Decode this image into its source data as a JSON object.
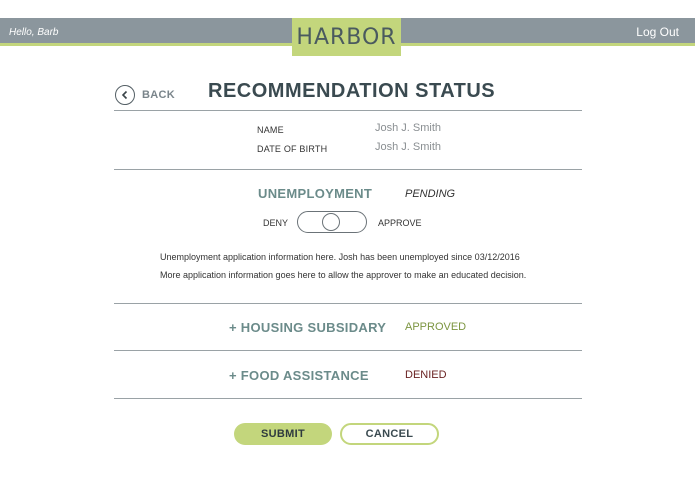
{
  "header": {
    "greeting": "Hello, Barb",
    "logo": "HARBOR",
    "logout_label": "Log Out"
  },
  "nav": {
    "back_label": "BACK"
  },
  "page": {
    "title": "RECOMMENDATION STATUS"
  },
  "person": {
    "name_label": "NAME",
    "name_value": "Josh J. Smith",
    "dob_label": "DATE OF BIRTH",
    "dob_value": "Josh J. Smith"
  },
  "unemployment": {
    "title": "UNEMPLOYMENT",
    "status": "PENDING",
    "deny_label": "DENY",
    "approve_label": "APPROVE",
    "info_line1": "Unemployment application information here. Josh has been unemployed since 03/12/2016",
    "info_line2": "More application information goes here to allow the approver to make an educated decision."
  },
  "housing": {
    "title": "+ HOUSING SUBSIDARY",
    "status": "APPROVED"
  },
  "food": {
    "title": "+ FOOD ASSISTANCE",
    "status": "DENIED"
  },
  "actions": {
    "submit_label": "SUBMIT",
    "cancel_label": "CANCEL"
  },
  "colors": {
    "accent": "#c3d67c",
    "header_bg": "#8b969d",
    "title_teal": "#6b8b8a",
    "approved": "#7c9540",
    "denied": "#6a2222"
  }
}
